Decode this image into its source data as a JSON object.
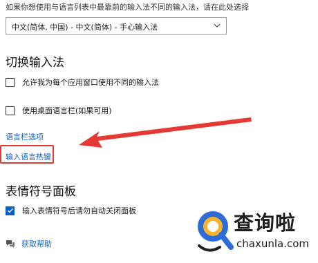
{
  "intro_text": "如果你想使用与语言列表中最靠前的输入法不同的输入法，请在此处选择",
  "ime_dropdown": {
    "value": "中文(简体, 中国) - 中文(简体) - 手心输入法",
    "icon": "chevron-down-icon"
  },
  "switch_section": {
    "title": "切换输入法",
    "options": [
      {
        "label": "允许我为每个应用窗口使用不同的输入法",
        "checked": false
      },
      {
        "label": "使用桌面语言栏(如果可用)",
        "checked": false
      }
    ],
    "language_bar_link": "语言栏选项",
    "hotkeys_link": "输入语言热键"
  },
  "emoji_section": {
    "title": "表情符号面板",
    "option": {
      "label": "输入表情符号后请勿自动关闭面板",
      "checked": true
    }
  },
  "help": {
    "icon": "help-chat-icon",
    "link": "获取帮助"
  },
  "annotation": {
    "arrow_color": "#e53935",
    "highlight_color": "#e53935"
  },
  "watermark": {
    "logo_text": "查询啦",
    "url": "chaxunla.com",
    "icon": "magnifier-logo-icon"
  },
  "colors": {
    "accent": "#0a5fc4",
    "link": "#1463c4"
  }
}
